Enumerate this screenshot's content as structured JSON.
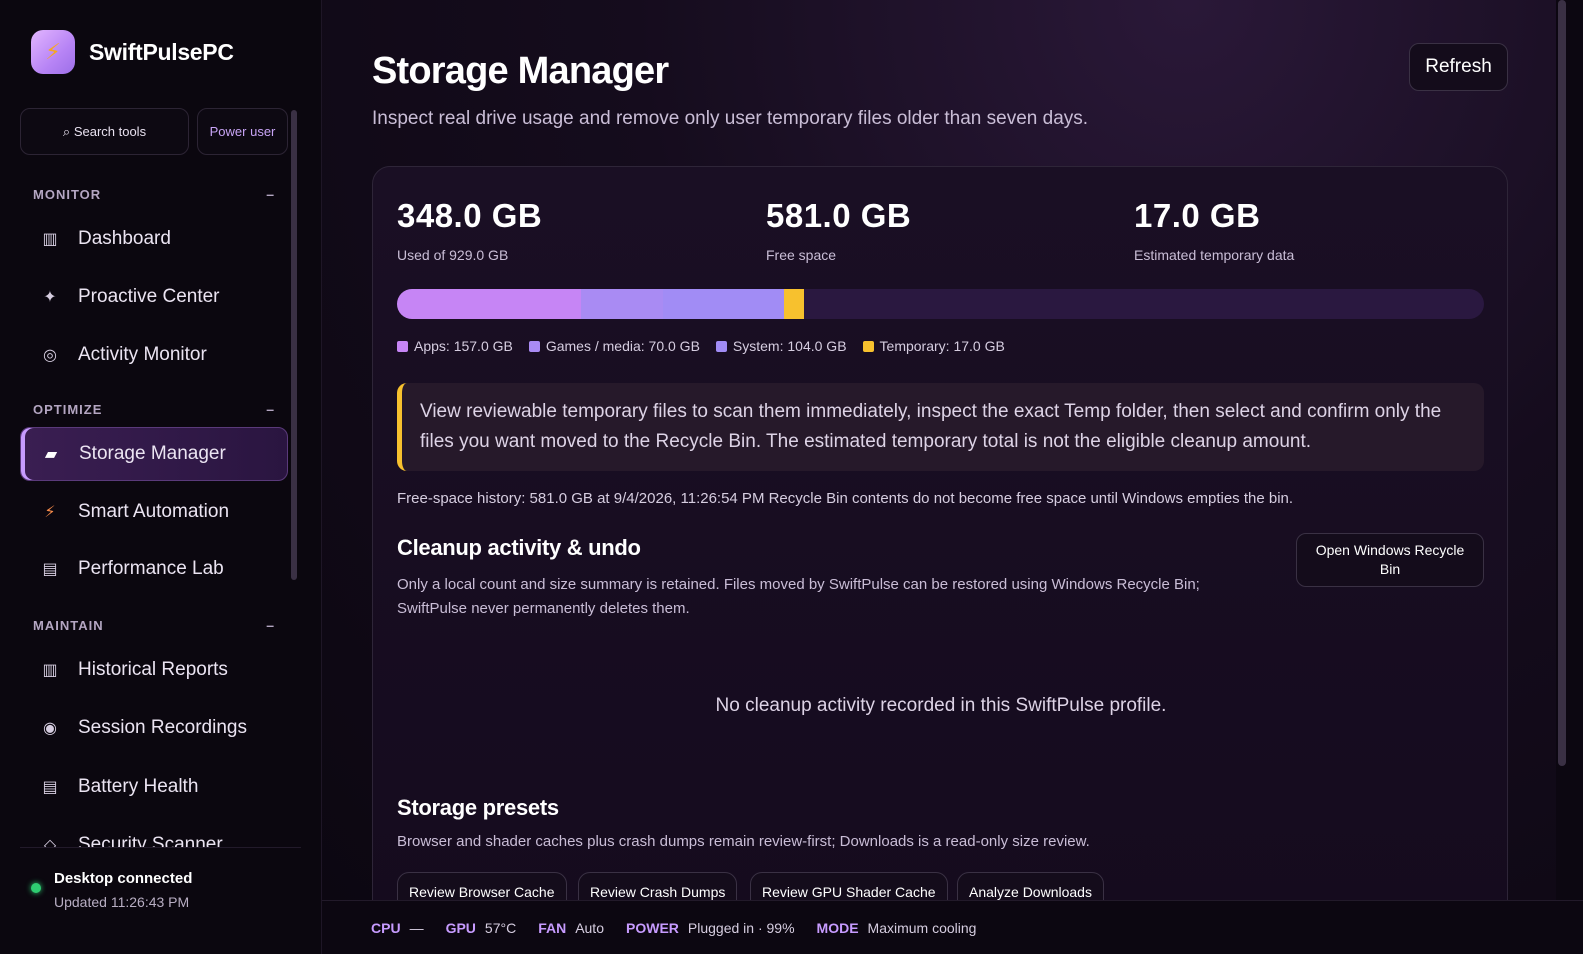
{
  "app": {
    "name": "SwiftPulsePC",
    "logo_icon": "bolt-icon"
  },
  "sidebar": {
    "search_label": "⌕ Search tools",
    "power_label": "Power user",
    "sections": [
      {
        "title": "MONITOR",
        "collapse": "–"
      },
      {
        "title": "OPTIMIZE",
        "collapse": "–"
      },
      {
        "title": "MAINTAIN",
        "collapse": "–"
      }
    ],
    "items": [
      {
        "label": "Dashboard",
        "icon": "▥"
      },
      {
        "label": "Proactive Center",
        "icon": "✦"
      },
      {
        "label": "Activity Monitor",
        "icon": "◎"
      },
      {
        "label": "Storage Manager",
        "icon": "▰"
      },
      {
        "label": "Smart Automation",
        "icon": "⚡"
      },
      {
        "label": "Performance Lab",
        "icon": "▤"
      },
      {
        "label": "Historical Reports",
        "icon": "▥"
      },
      {
        "label": "Session Recordings",
        "icon": "◉"
      },
      {
        "label": "Battery Health",
        "icon": "▤"
      },
      {
        "label": "Security Scanner",
        "icon": "◇"
      }
    ],
    "active_item": "Storage Manager",
    "status": {
      "title": "Desktop connected",
      "updated": "Updated 11:26:43 PM",
      "color": "#2ecc71"
    }
  },
  "header": {
    "title": "Storage Manager",
    "subtitle": "Inspect real drive usage and remove only user temporary files older than seven days.",
    "refresh_label": "Refresh"
  },
  "stats": {
    "used": {
      "value": "348.0 GB",
      "label": "Used of 929.0 GB"
    },
    "free": {
      "value": "581.0 GB",
      "label": "Free space"
    },
    "temp": {
      "value": "17.0 GB",
      "label": "Estimated temporary data"
    }
  },
  "usage": {
    "total_gb": 929.0,
    "segments": [
      {
        "name": "Apps",
        "gb": 157.0,
        "label": "Apps: 157.0 GB",
        "color": "#c685f5"
      },
      {
        "name": "Games / media",
        "gb": 70.0,
        "label": "Games / media: 70.0 GB",
        "color": "#a98bf3"
      },
      {
        "name": "System",
        "gb": 104.0,
        "label": "System: 104.0 GB",
        "color": "#a18cf5"
      },
      {
        "name": "Temporary",
        "gb": 17.0,
        "label": "Temporary: 17.0 GB",
        "color": "#f7c12e"
      }
    ]
  },
  "notice": "View reviewable temporary files to scan them immediately, inspect the exact Temp folder, then select and confirm only the files you want moved to the Recycle Bin. The estimated temporary total is not the eligible cleanup amount.",
  "history": "Free-space history: 581.0 GB at 9/4/2026, 11:26:54 PM Recycle Bin contents do not become free space until Windows empties the bin.",
  "cleanup": {
    "title": "Cleanup activity & undo",
    "desc": "Only a local count and size summary is retained. Files moved by SwiftPulse can be restored using Windows Recycle Bin; SwiftPulse never permanently deletes them.",
    "open_recycle_label": "Open Windows Recycle Bin",
    "empty": "No cleanup activity recorded in this SwiftPulse profile."
  },
  "presets": {
    "title": "Storage presets",
    "desc": "Browser and shader caches plus crash dumps remain review-first; Downloads is a read-only size review.",
    "buttons": [
      "Review Browser Cache",
      "Review Crash Dumps",
      "Review GPU Shader Cache",
      "Analyze Downloads"
    ]
  },
  "statusbar": [
    {
      "key": "CPU",
      "value": "—"
    },
    {
      "key": "GPU",
      "value": "57°C"
    },
    {
      "key": "FAN",
      "value": "Auto"
    },
    {
      "key": "POWER",
      "value": "Plugged in · 99%"
    },
    {
      "key": "MODE",
      "value": "Maximum cooling"
    }
  ]
}
